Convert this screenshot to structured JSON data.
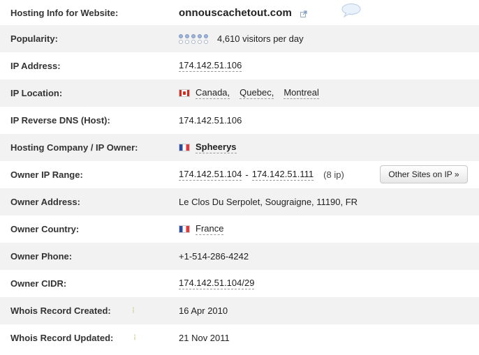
{
  "rows": {
    "hosting_info": {
      "label": "Hosting Info for Website:",
      "site": "onnouscachetout.com"
    },
    "popularity": {
      "label": "Popularity:",
      "value": "4,610 visitors per day",
      "level": 0.5
    },
    "ip_address": {
      "label": "IP Address:",
      "value": "174.142.51.106"
    },
    "ip_location": {
      "label": "IP Location:",
      "country": "Canada,",
      "region": "Quebec,",
      "city": "Montreal"
    },
    "reverse_dns": {
      "label": "IP Reverse DNS (Host):",
      "value": "174.142.51.106"
    },
    "hosting_company": {
      "label": "Hosting Company / IP Owner:",
      "value": "Spheerys"
    },
    "owner_ip_range": {
      "label": "Owner IP Range:",
      "start": "174.142.51.104",
      "dash": "-",
      "end": "174.142.51.111",
      "count": "(8 ip)",
      "button": "Other Sites on IP »"
    },
    "owner_address": {
      "label": "Owner Address:",
      "value": "Le Clos Du Serpolet, Sougraigne, 11190, FR"
    },
    "owner_country": {
      "label": "Owner Country:",
      "value": "France"
    },
    "owner_phone": {
      "label": "Owner Phone:",
      "value": "+1-514-286-4242"
    },
    "owner_cidr": {
      "label": "Owner CIDR:",
      "value": "174.142.51.104/29"
    },
    "whois_created": {
      "label": "Whois Record Created:",
      "value": "16 Apr 2010"
    },
    "whois_updated": {
      "label": "Whois Record Updated:",
      "value": "21 Nov 2011"
    }
  },
  "icons": {
    "external_link": "external-link-icon",
    "comment": "speech-bubble-icon",
    "info": "info-icon",
    "flag_canada": "canada-flag-icon",
    "flag_france": "france-flag-icon"
  },
  "colors": {
    "alt_row": "#f2f2f2",
    "dots_on": "#9fb4d8",
    "dots_off": "#ffffff"
  }
}
